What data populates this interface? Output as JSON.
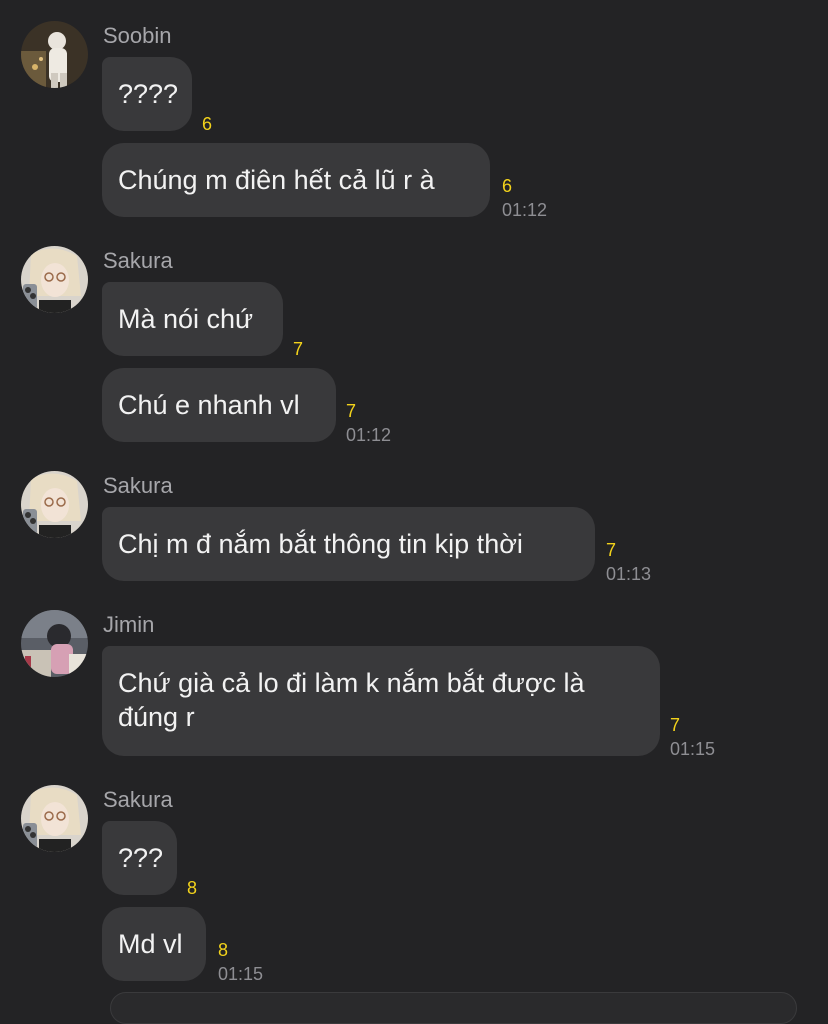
{
  "groups": [
    {
      "sender": "Soobin",
      "avatar": "soobin-avatar",
      "messages": [
        {
          "text": "????",
          "count": "6",
          "time": ""
        },
        {
          "text": "Chúng m điên hết cả lũ r à",
          "count": "6",
          "time": "01:12"
        }
      ]
    },
    {
      "sender": "Sakura",
      "avatar": "sakura-avatar",
      "messages": [
        {
          "text": "Mà nói chứ",
          "count": "7",
          "time": ""
        },
        {
          "text": "Chú e nhanh vl",
          "count": "7",
          "time": "01:12"
        }
      ]
    },
    {
      "sender": "Sakura",
      "avatar": "sakura-avatar",
      "messages": [
        {
          "text": "Chị m đ nắm bắt thông tin kịp thời",
          "count": "7",
          "time": "01:13"
        }
      ]
    },
    {
      "sender": "Jimin",
      "avatar": "jimin-avatar",
      "messages": [
        {
          "text": "Chứ già cả lo đi làm k nắm bắt được là đúng r",
          "count": "7",
          "time": "01:15"
        }
      ]
    },
    {
      "sender": "Sakura",
      "avatar": "sakura-avatar",
      "messages": [
        {
          "text": "???",
          "count": "8",
          "time": ""
        },
        {
          "text": "Md vl",
          "count": "8",
          "time": "01:15"
        }
      ]
    }
  ]
}
